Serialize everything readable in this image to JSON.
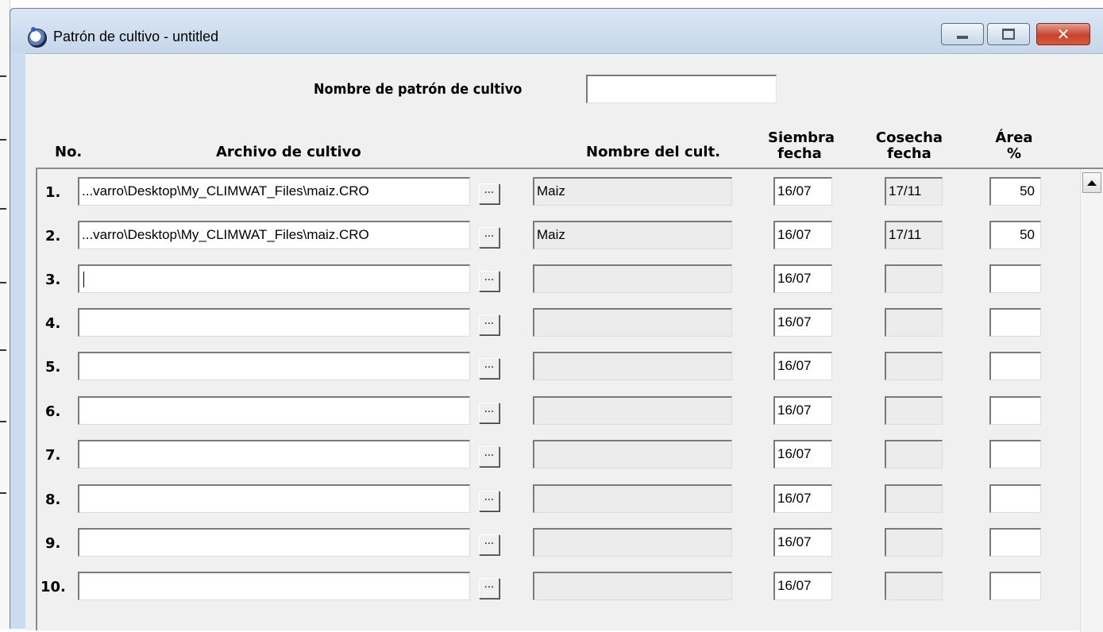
{
  "window": {
    "title": "Patrón de cultivo - untitled",
    "icon": "globe-icon",
    "controls": [
      "minimize-icon",
      "maximize-icon",
      "close-icon"
    ]
  },
  "pattern": {
    "label": "Nombre de patrón de cultivo",
    "value": ""
  },
  "headers": {
    "no": "No.",
    "archivo": "Archivo de cultivo",
    "nombre": "Nombre del cult.",
    "siembra_1": "Siembra",
    "siembra_2": "fecha",
    "cosecha_1": "Cosecha",
    "cosecha_2": "fecha",
    "area_1": "Área",
    "area_2": "%"
  },
  "browse_label": "...",
  "rows": [
    {
      "no": "1.",
      "archivo": "...varro\\Desktop\\My_CLIMWAT_Files\\maiz.CRO",
      "nombre": "Maiz",
      "siembra": "16/07",
      "cosecha": "17/11",
      "area": "50"
    },
    {
      "no": "2.",
      "archivo": "...varro\\Desktop\\My_CLIMWAT_Files\\maiz.CRO",
      "nombre": "Maiz",
      "siembra": "16/07",
      "cosecha": "17/11",
      "area": "50"
    },
    {
      "no": "3.",
      "archivo": "",
      "nombre": "",
      "siembra": "16/07",
      "cosecha": "",
      "area": ""
    },
    {
      "no": "4.",
      "archivo": "",
      "nombre": "",
      "siembra": "16/07",
      "cosecha": "",
      "area": ""
    },
    {
      "no": "5.",
      "archivo": "",
      "nombre": "",
      "siembra": "16/07",
      "cosecha": "",
      "area": ""
    },
    {
      "no": "6.",
      "archivo": "",
      "nombre": "",
      "siembra": "16/07",
      "cosecha": "",
      "area": ""
    },
    {
      "no": "7.",
      "archivo": "",
      "nombre": "",
      "siembra": "16/07",
      "cosecha": "",
      "area": ""
    },
    {
      "no": "8.",
      "archivo": "",
      "nombre": "",
      "siembra": "16/07",
      "cosecha": "",
      "area": ""
    },
    {
      "no": "9.",
      "archivo": "",
      "nombre": "",
      "siembra": "16/07",
      "cosecha": "",
      "area": ""
    },
    {
      "no": "10.",
      "archivo": "",
      "nombre": "",
      "siembra": "16/07",
      "cosecha": "",
      "area": ""
    }
  ]
}
